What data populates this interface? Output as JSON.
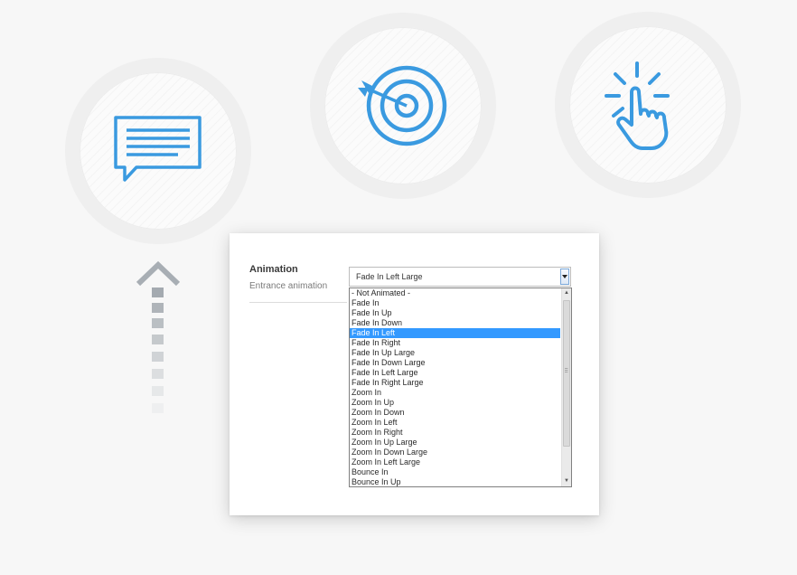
{
  "features": [
    {
      "icon": "speech-bubble-icon"
    },
    {
      "icon": "target-icon"
    },
    {
      "icon": "tap-hand-icon"
    }
  ],
  "arrow": {
    "icon": "dotted-up-arrow-icon"
  },
  "panel": {
    "label": "Animation",
    "sublabel": "Entrance animation",
    "select": {
      "value": "Fade In Left Large",
      "options": [
        "- Not Animated -",
        "Fade In",
        "Fade In Up",
        "Fade In Down",
        "Fade In Left",
        "Fade In Right",
        "Fade In Up Large",
        "Fade In Down Large",
        "Fade In Left Large",
        "Fade In Right Large",
        "Zoom In",
        "Zoom In Up",
        "Zoom In Down",
        "Zoom In Left",
        "Zoom In Right",
        "Zoom In Up Large",
        "Zoom In Down Large",
        "Zoom In Left Large",
        "Bounce In",
        "Bounce In Up"
      ],
      "highlighted": "Fade In Left"
    }
  },
  "colors": {
    "accent": "#3a9ae0",
    "highlight": "#3399ff"
  }
}
